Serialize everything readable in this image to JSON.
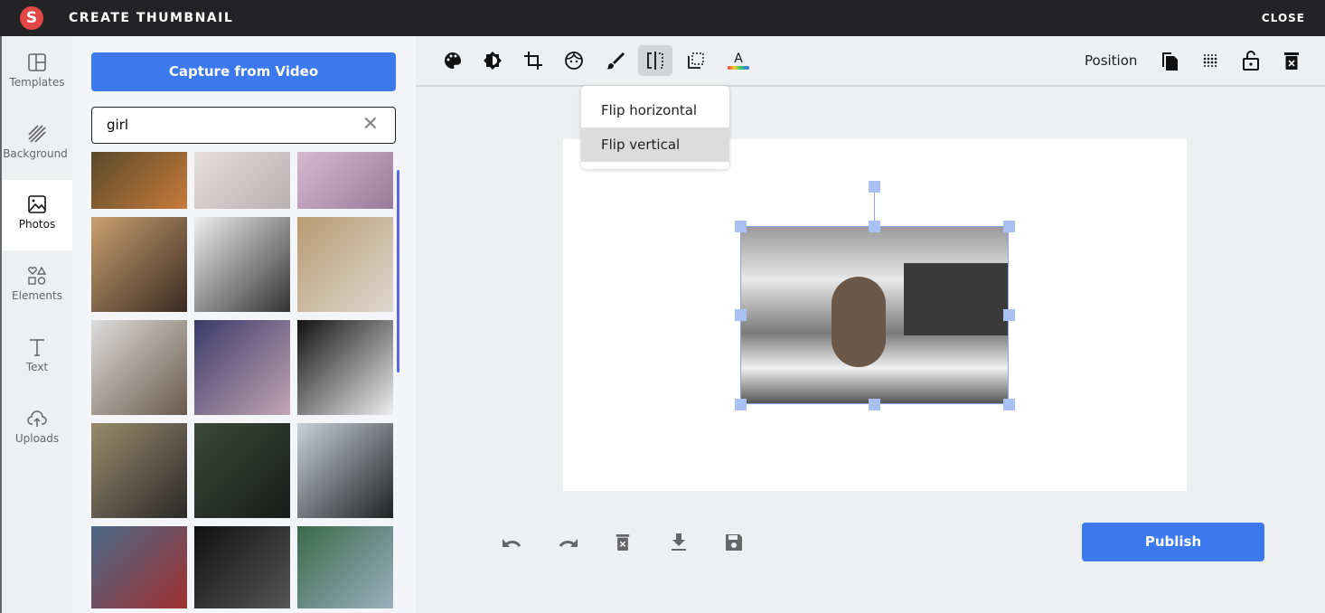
{
  "header": {
    "logo": "S",
    "title": "CREATE THUMBNAIL",
    "close_label": "CLOSE"
  },
  "rail": {
    "items": [
      {
        "label": "Templates",
        "icon": "templates-icon"
      },
      {
        "label": "Background",
        "icon": "background-icon"
      },
      {
        "label": "Photos",
        "icon": "photos-icon",
        "active": true
      },
      {
        "label": "Elements",
        "icon": "elements-icon"
      },
      {
        "label": "Text",
        "icon": "text-icon"
      },
      {
        "label": "Uploads",
        "icon": "uploads-icon"
      }
    ]
  },
  "panel": {
    "capture_label": "Capture from Video",
    "search": {
      "value": "girl",
      "clear_icon": "close-icon"
    }
  },
  "toolbar": {
    "icons": [
      "palette-icon",
      "brightness-icon",
      "crop-icon",
      "face-icon",
      "brush-icon",
      "flip-icon",
      "transparency-icon",
      "text-color-icon"
    ],
    "position_label": "Position",
    "right_icons": [
      "duplicate-icon",
      "opacity-icon",
      "unlock-icon",
      "delete-icon"
    ]
  },
  "flip_menu": {
    "items": [
      "Flip horizontal",
      "Flip vertical"
    ],
    "highlighted": "Flip vertical"
  },
  "bottom": {
    "icons": [
      "undo-icon",
      "redo-icon",
      "delete-icon",
      "download-icon",
      "save-icon"
    ],
    "publish_label": "Publish"
  }
}
